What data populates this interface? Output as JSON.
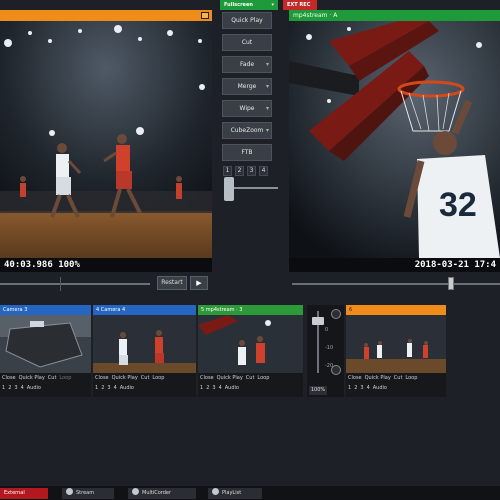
{
  "top": {
    "fade_tab": "Fullscreen",
    "ftb_tab": "EXT REC"
  },
  "preview": {
    "title": "",
    "timecode": "40:03.986",
    "zoom": "100%"
  },
  "program": {
    "title": "mp4stream · A",
    "timestamp": "2018-03-21 17:4"
  },
  "transitions": {
    "quick_play": "Quick Play",
    "cut": "Cut",
    "fade": "Fade",
    "merge": "Merge",
    "wipe": "Wipe",
    "cube_zoom": "CubeZoom",
    "ftb": "FTB",
    "numbers": [
      "1",
      "2",
      "3",
      "4"
    ]
  },
  "timeline": {
    "restart_label": "Restart",
    "play_label": "▶",
    "position": 0.78
  },
  "inputs": [
    {
      "number": "",
      "name": "Camera 3",
      "controls": [
        "Close",
        "Quick Play",
        "Cut",
        "Loop"
      ],
      "bottom": [
        "1",
        "2",
        "3",
        "4",
        "Audio"
      ]
    },
    {
      "number": "4",
      "name": "Camera 4",
      "controls": [
        "Close",
        "Quick Play",
        "Cut",
        "Loop"
      ],
      "bottom": [
        "1",
        "2",
        "3",
        "4",
        "Audio"
      ]
    },
    {
      "number": "5",
      "name": "mp4stream · 3",
      "controls": [
        "Close",
        "Quick Play",
        "Cut",
        "Loop"
      ],
      "bottom": [
        "1",
        "2",
        "3",
        "4",
        "Audio"
      ]
    },
    {
      "number": "6",
      "name": "",
      "controls": [
        "Close",
        "Quick Play",
        "Cut",
        "Loop"
      ],
      "bottom": [
        "1",
        "2",
        "3",
        "4",
        "Audio"
      ]
    }
  ],
  "mixer": {
    "db_marks": [
      "0",
      "-10",
      "-20"
    ],
    "percent": "100%",
    "level": 0.9
  },
  "bottom_bar": {
    "external": "External",
    "stream": "Stream",
    "multicorder": "MultiCorder",
    "playlist": "PlayList"
  },
  "colors": {
    "preview_bar": "#f08c1a",
    "program_bar": "#1e9a3a",
    "input_blue": "#2466c2",
    "input_green": "#2d9a3a",
    "input_orange": "#f08c1a",
    "external_red": "#b3181f"
  }
}
